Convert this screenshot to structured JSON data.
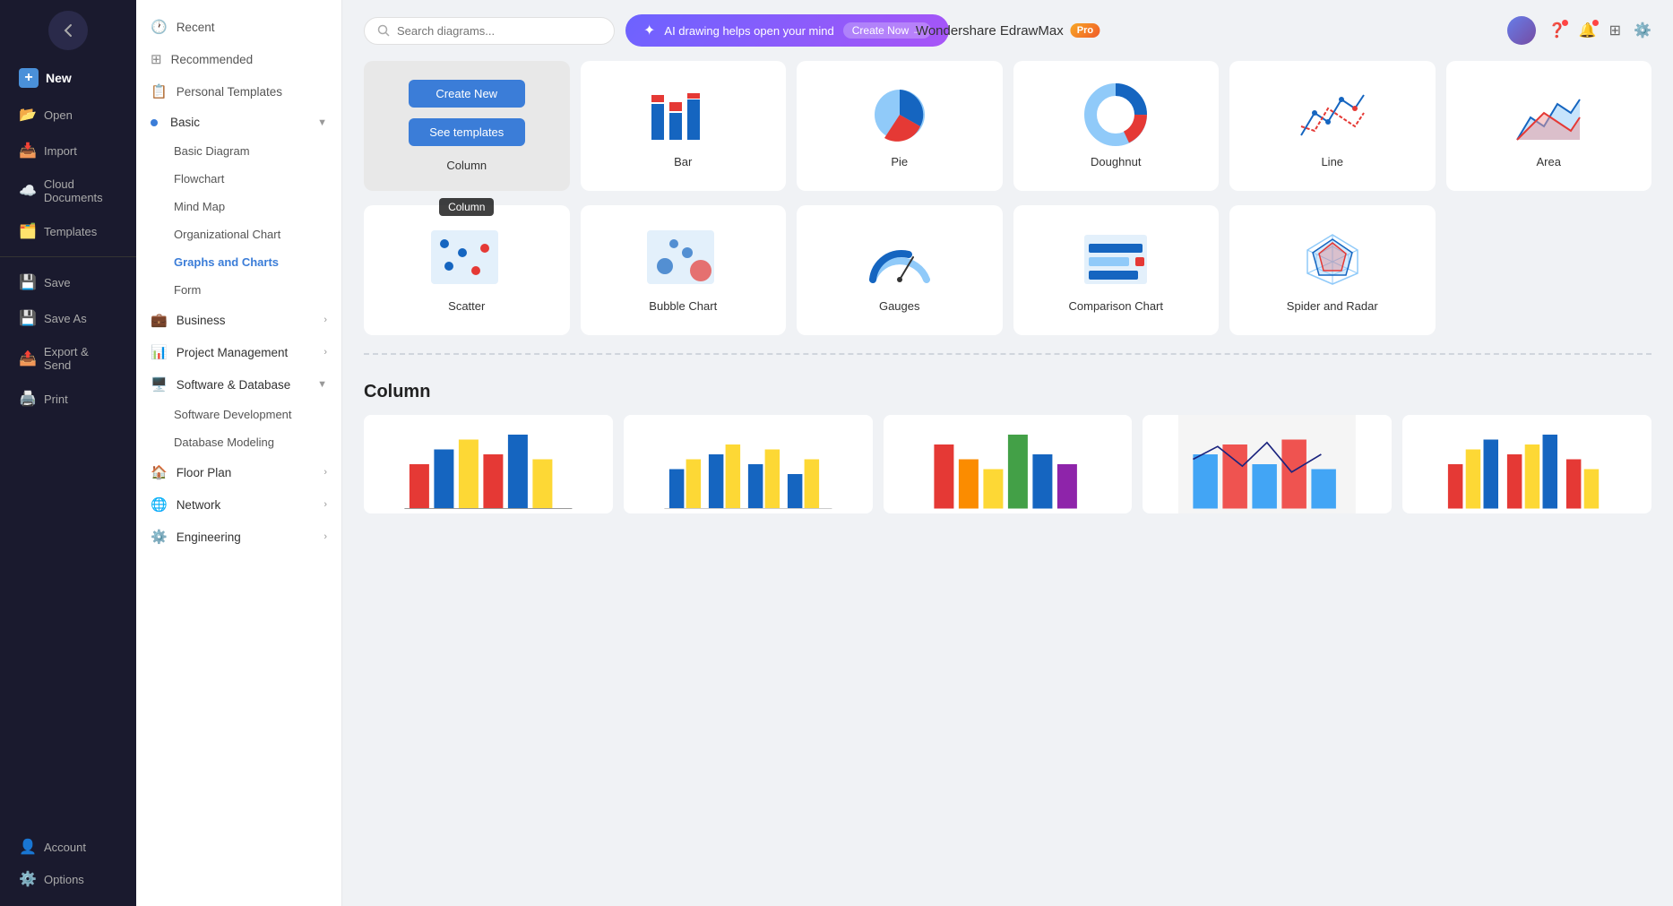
{
  "app": {
    "title": "Wondershare EdrawMax",
    "pro_label": "Pro"
  },
  "left_nav": {
    "back_label": "←",
    "items": [
      {
        "id": "new",
        "label": "New",
        "icon": "📄"
      },
      {
        "id": "open",
        "label": "Open",
        "icon": "📂"
      },
      {
        "id": "import",
        "label": "Import",
        "icon": "📥"
      },
      {
        "id": "cloud",
        "label": "Cloud Documents",
        "icon": "☁️"
      },
      {
        "id": "templates",
        "label": "Templates",
        "icon": "🗂️"
      },
      {
        "id": "save",
        "label": "Save",
        "icon": "💾"
      },
      {
        "id": "saveas",
        "label": "Save As",
        "icon": "💾"
      },
      {
        "id": "export",
        "label": "Export & Send",
        "icon": "📤"
      },
      {
        "id": "print",
        "label": "Print",
        "icon": "🖨️"
      }
    ],
    "bottom_items": [
      {
        "id": "account",
        "label": "Account",
        "icon": "👤"
      },
      {
        "id": "options",
        "label": "Options",
        "icon": "⚙️"
      }
    ]
  },
  "mid_nav": {
    "top_items": [
      {
        "id": "recent",
        "label": "Recent",
        "icon": "🕐"
      },
      {
        "id": "recommended",
        "label": "Recommended",
        "icon": "⊞"
      },
      {
        "id": "personal",
        "label": "Personal Templates",
        "icon": "📋"
      }
    ],
    "categories": [
      {
        "id": "basic",
        "label": "Basic",
        "icon": "◆",
        "expanded": true,
        "active": false,
        "sub": [
          "Basic Diagram",
          "Flowchart",
          "Mind Map",
          "Organizational Chart",
          "Graphs and Charts",
          "Form"
        ]
      },
      {
        "id": "business",
        "label": "Business",
        "icon": "💼",
        "expanded": false
      },
      {
        "id": "project",
        "label": "Project Management",
        "icon": "📊",
        "expanded": false
      },
      {
        "id": "software",
        "label": "Software & Database",
        "icon": "🖥️",
        "expanded": true,
        "sub": [
          "Software Development",
          "Database Modeling"
        ]
      },
      {
        "id": "floor",
        "label": "Floor Plan",
        "icon": "🏠",
        "expanded": false
      },
      {
        "id": "network",
        "label": "Network",
        "icon": "🌐",
        "expanded": false
      },
      {
        "id": "engineering",
        "label": "Engineering",
        "icon": "⚙️",
        "expanded": false
      }
    ],
    "active_sub": "Graphs and Charts"
  },
  "search": {
    "placeholder": "Search diagrams..."
  },
  "ai_banner": {
    "text": "AI drawing helps open your mind",
    "cta": "Create Now →"
  },
  "chart_types": [
    {
      "id": "column",
      "label": "Column",
      "selected": true
    },
    {
      "id": "bar",
      "label": "Bar"
    },
    {
      "id": "pie",
      "label": "Pie"
    },
    {
      "id": "doughnut",
      "label": "Doughnut"
    },
    {
      "id": "line",
      "label": "Line"
    },
    {
      "id": "area",
      "label": "Area"
    },
    {
      "id": "scatter",
      "label": "Scatter"
    },
    {
      "id": "bubble",
      "label": "Bubble Chart"
    },
    {
      "id": "gauges",
      "label": "Gauges"
    },
    {
      "id": "comparison",
      "label": "Comparison Chart"
    },
    {
      "id": "spider",
      "label": "Spider and Radar"
    }
  ],
  "card_buttons": {
    "create_new": "Create New",
    "see_templates": "See templates"
  },
  "tooltip": "Column",
  "column_section": {
    "title": "Column"
  }
}
